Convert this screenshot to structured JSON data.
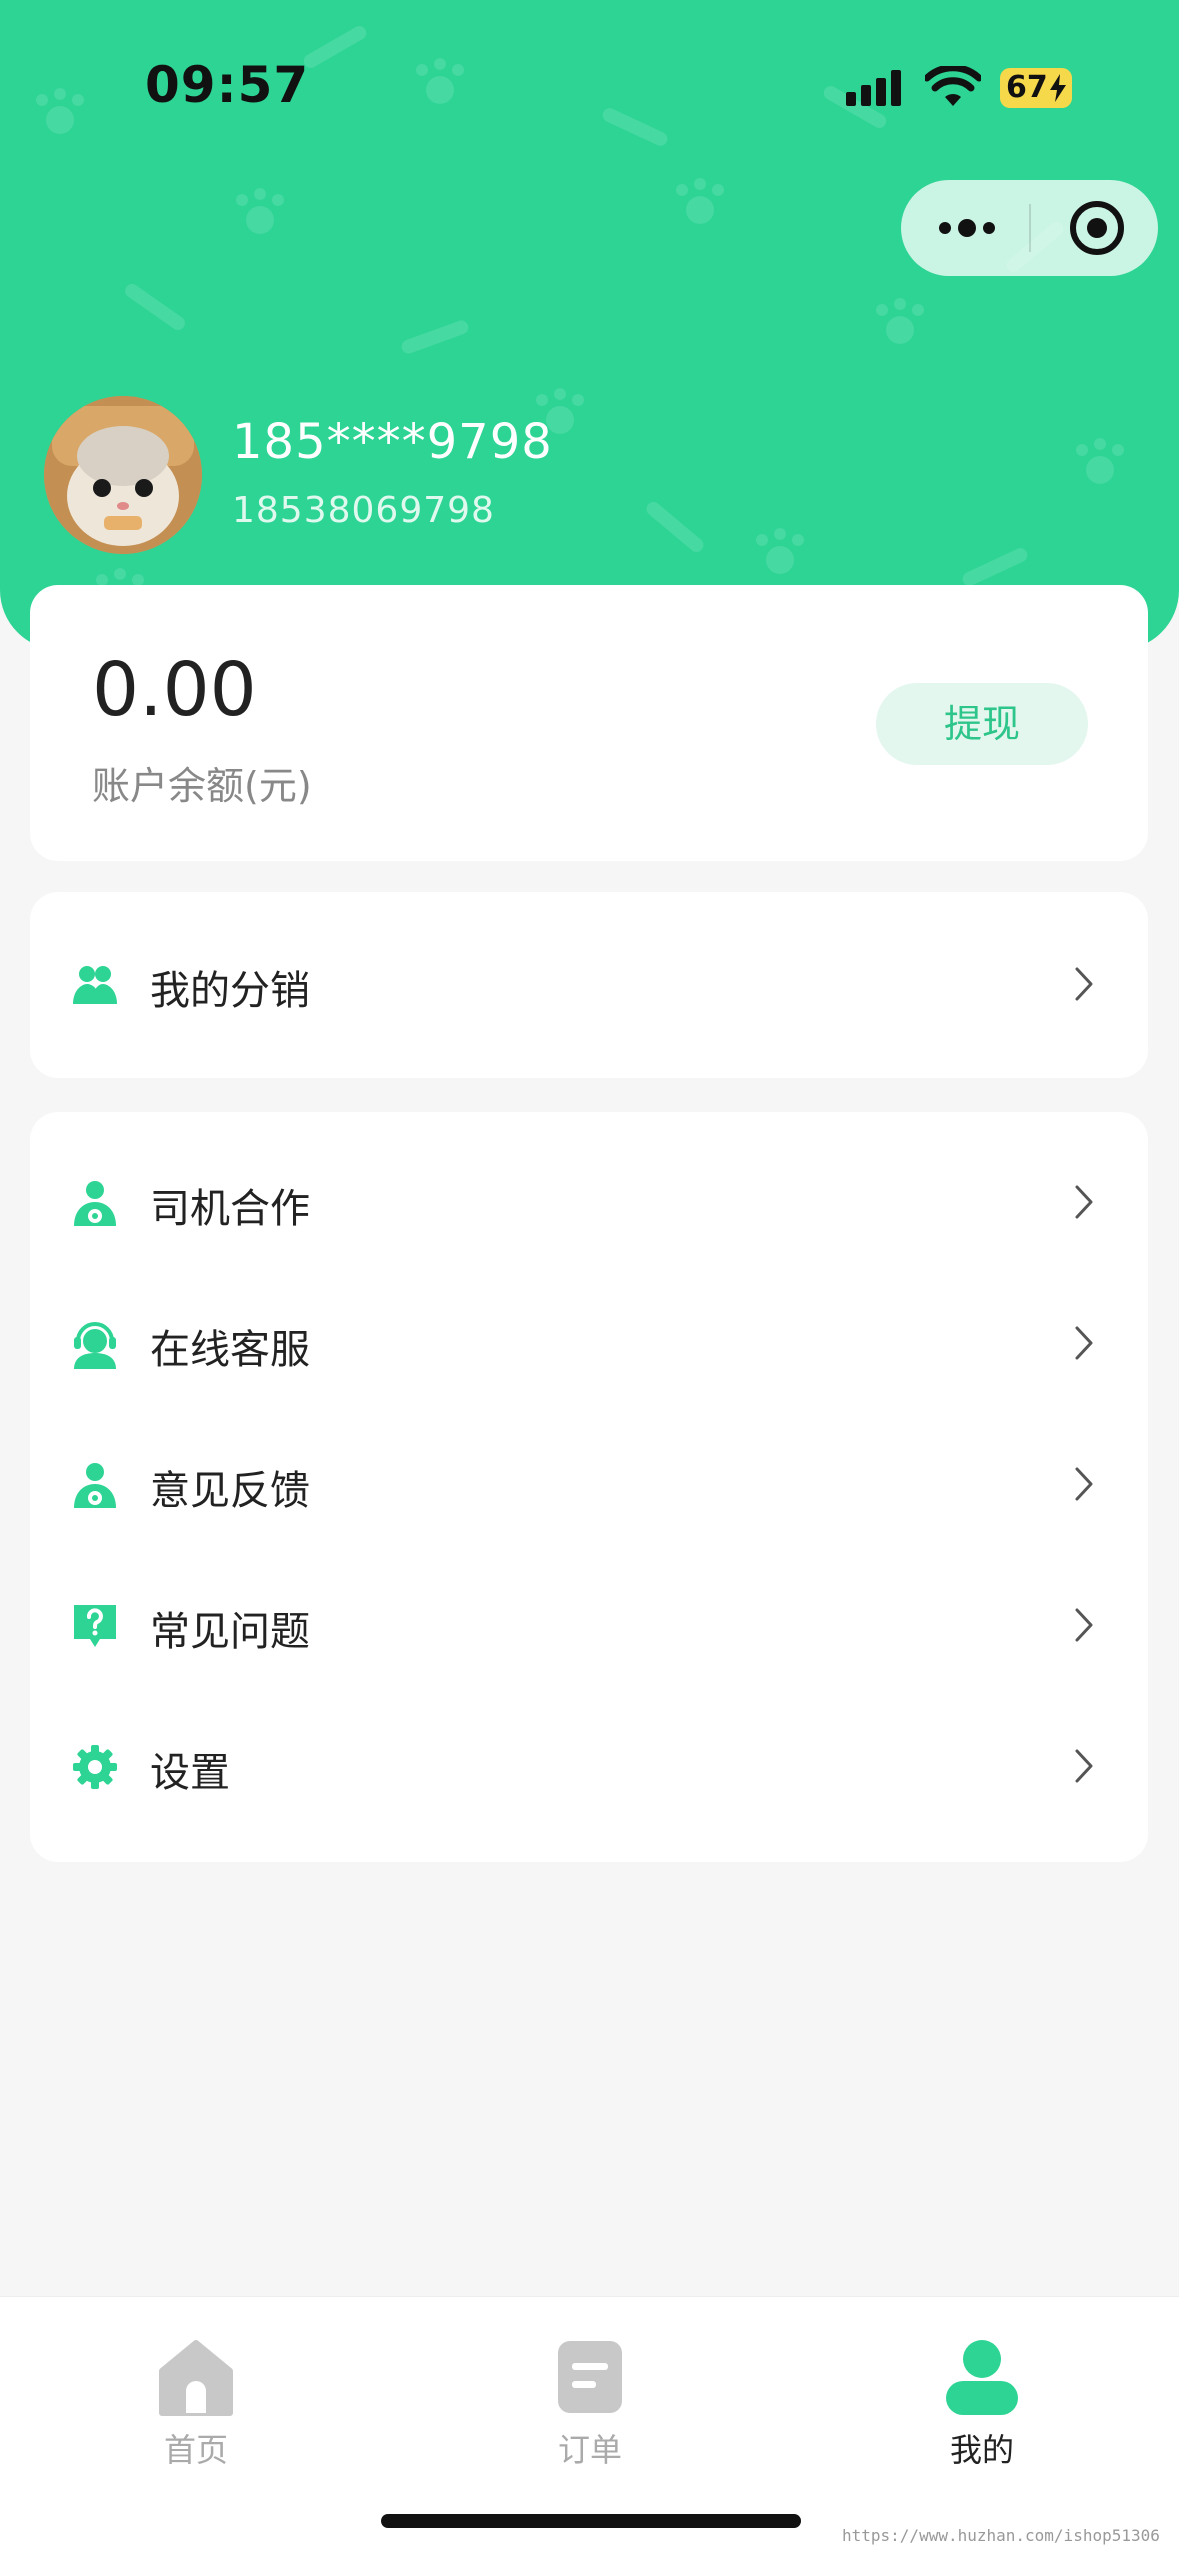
{
  "status_bar": {
    "time": "09:57",
    "battery": "67"
  },
  "user": {
    "nickname": "185****9798",
    "phone": "18538069798"
  },
  "balance": {
    "amount": "0.00",
    "label": "账户余额(元)",
    "withdraw_label": "提现"
  },
  "distribution": {
    "label": "我的分销"
  },
  "menu": [
    {
      "label": "司机合作",
      "icon": "driver-icon"
    },
    {
      "label": "在线客服",
      "icon": "customer-service-icon"
    },
    {
      "label": "意见反馈",
      "icon": "feedback-icon"
    },
    {
      "label": "常见问题",
      "icon": "question-icon"
    },
    {
      "label": "设置",
      "icon": "gear-icon"
    }
  ],
  "tabbar": [
    {
      "label": "首页",
      "icon": "home-icon"
    },
    {
      "label": "订单",
      "icon": "order-icon"
    },
    {
      "label": "我的",
      "icon": "user-icon"
    }
  ],
  "watermark": "https://www.huzhan.com/ishop51306",
  "colors": {
    "brand": "#2dd494",
    "accent_text": "#2dc58a",
    "withdraw_bg": "#e3f7ee",
    "background": "#f6f6f6"
  }
}
